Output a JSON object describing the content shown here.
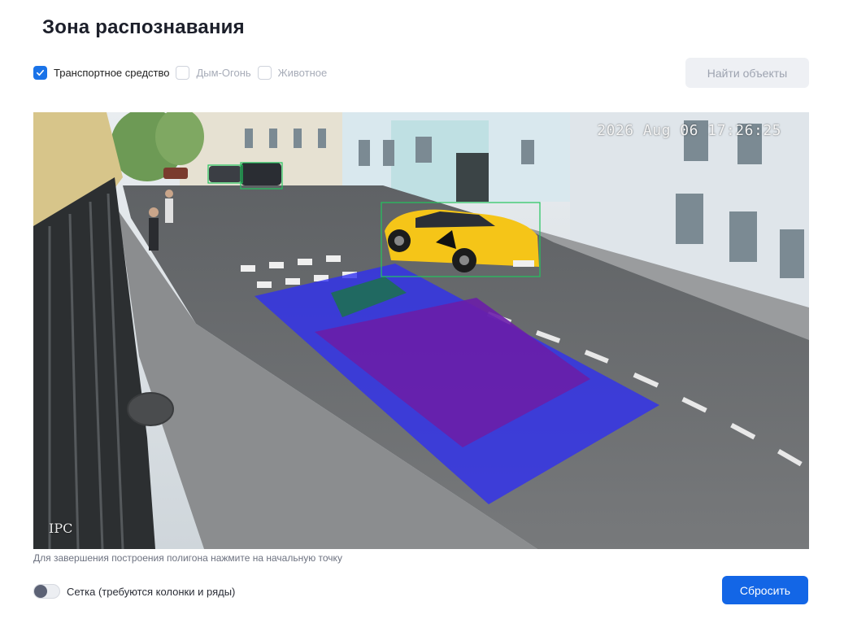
{
  "page": {
    "title": "Зона распознавания",
    "hint": "Для завершения построения полигона нажмите на начальную точку"
  },
  "filters": [
    {
      "label": "Транспортное средство",
      "checked": true
    },
    {
      "label": "Дым-Огонь",
      "checked": false
    },
    {
      "label": "Животное",
      "checked": false
    }
  ],
  "buttons": {
    "find_objects": "Найти объекты",
    "reset": "Сбросить"
  },
  "camera": {
    "timestamp": "2026  Aug 06 17:26:25",
    "label": "IPC",
    "overlays": {
      "zone_fill_color": "#2f2ff0",
      "inner_zone_color": "#6a1ea8",
      "small_zone_color": "#1f6b5b",
      "detection_box_color": "#22c55e"
    }
  },
  "grid_toggle": {
    "label": "Сетка (требуются колонки и ряды)",
    "enabled": false
  },
  "colors": {
    "accent": "#1366e6",
    "checkbox_checked": "#1a73e8"
  }
}
